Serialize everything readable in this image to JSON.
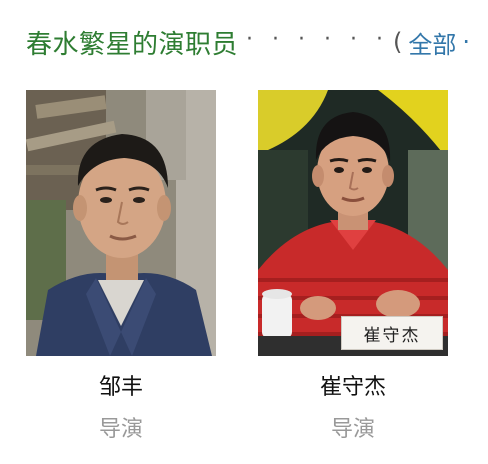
{
  "header": {
    "title": "春水繁星的演职员",
    "dots": "· · · · · ·",
    "paren": "(",
    "all_label": "全部",
    "all_tail": "·"
  },
  "people": [
    {
      "name": "邹丰",
      "role": "导演"
    },
    {
      "name": "崔守杰",
      "role": "导演",
      "nameplate": "崔守杰"
    }
  ]
}
